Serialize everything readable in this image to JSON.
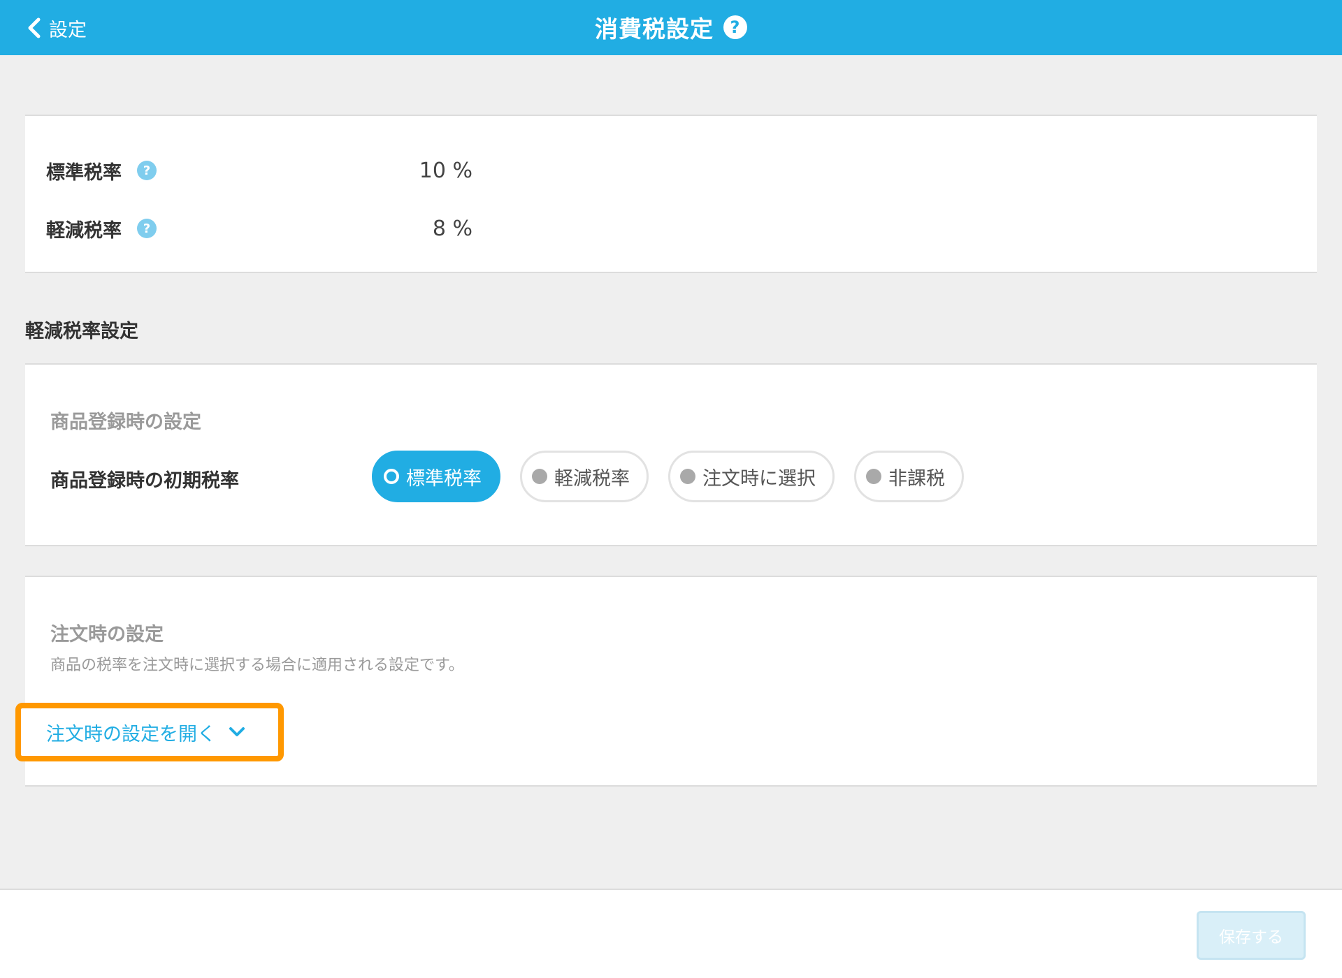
{
  "header": {
    "back_label": "設定",
    "title": "消費税設定",
    "help_glyph": "?"
  },
  "tax_rates": {
    "standard": {
      "label": "標準税率",
      "value": "10 %"
    },
    "reduced": {
      "label": "軽減税率",
      "value": "8 %"
    }
  },
  "reduced_settings": {
    "section_title": "軽減税率設定",
    "product_registration": {
      "heading": "商品登録時の設定",
      "field_label": "商品登録時の初期税率",
      "options": [
        {
          "label": "標準税率",
          "selected": true
        },
        {
          "label": "軽減税率",
          "selected": false
        },
        {
          "label": "注文時に選択",
          "selected": false
        },
        {
          "label": "非課税",
          "selected": false
        }
      ]
    },
    "order_settings": {
      "heading": "注文時の設定",
      "description": "商品の税率を注文時に選択する場合に適用される設定です。",
      "open_link": "注文時の設定を開く"
    }
  },
  "footer": {
    "save_label": "保存する"
  },
  "colors": {
    "accent": "#21ade3",
    "highlight": "#ff9800",
    "help_icon": "#7fcdee",
    "background": "#efefef"
  },
  "icons": {
    "back": "chevron-left-icon",
    "help": "question-circle-icon",
    "expand": "chevron-down-icon"
  }
}
